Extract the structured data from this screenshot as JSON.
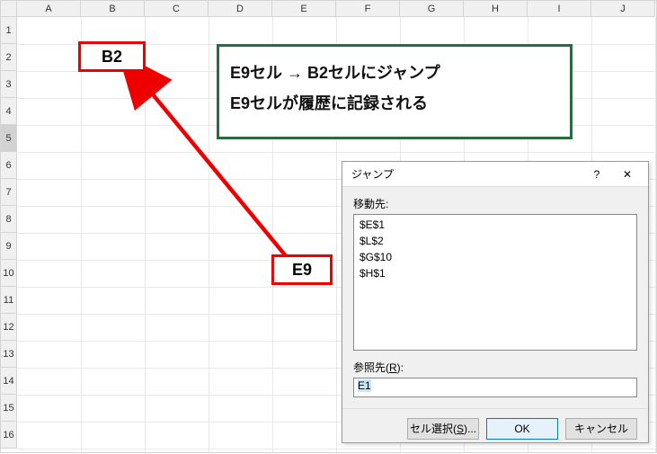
{
  "columns": [
    "A",
    "B",
    "C",
    "D",
    "E",
    "F",
    "G",
    "H",
    "I",
    "J"
  ],
  "rows": [
    "1",
    "2",
    "3",
    "4",
    "5",
    "6",
    "7",
    "8",
    "9",
    "10",
    "11",
    "12",
    "13",
    "14",
    "15",
    "16"
  ],
  "cells": {
    "B2_label": "B2",
    "E9_label": "E9"
  },
  "explain": {
    "line1": "E9セル → B2セルにジャンプ",
    "line2": "E9セルが履歴に記録される"
  },
  "dialog": {
    "title": "ジャンプ",
    "help_glyph": "?",
    "close_glyph": "✕",
    "move_to_label": "移動先:",
    "history": [
      "$E$1",
      "$L$2",
      "$G$10",
      "$H$1"
    ],
    "ref_label_pre": "参照先(",
    "ref_label_key": "R",
    "ref_label_post": "):",
    "ref_value": "E1",
    "select_btn_pre": "セル選択(",
    "select_btn_key": "S",
    "select_btn_post": ")...",
    "ok": "OK",
    "cancel": "キャンセル"
  }
}
